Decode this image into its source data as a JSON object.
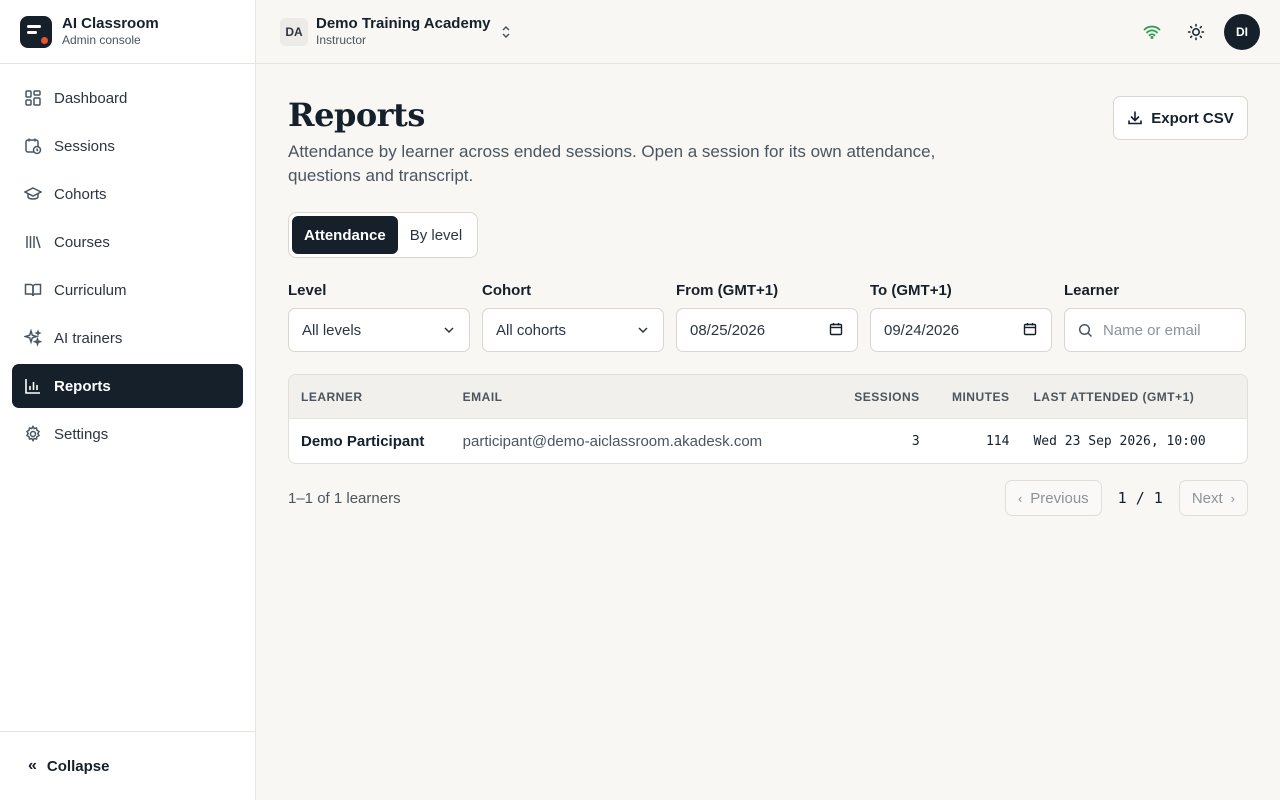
{
  "brand": {
    "title": "AI Classroom",
    "subtitle": "Admin console"
  },
  "org": {
    "badge": "DA",
    "name": "Demo Training Academy",
    "role": "Instructor"
  },
  "user": {
    "initials": "DI"
  },
  "sidebar": {
    "items": [
      {
        "label": "Dashboard",
        "icon": "dashboard-icon"
      },
      {
        "label": "Sessions",
        "icon": "sessions-icon"
      },
      {
        "label": "Cohorts",
        "icon": "cohorts-icon"
      },
      {
        "label": "Courses",
        "icon": "courses-icon"
      },
      {
        "label": "Curriculum",
        "icon": "curriculum-icon"
      },
      {
        "label": "AI trainers",
        "icon": "ai-trainers-icon"
      },
      {
        "label": "Reports",
        "icon": "reports-icon",
        "active": true
      },
      {
        "label": "Settings",
        "icon": "settings-icon"
      }
    ],
    "collapse_label": "Collapse"
  },
  "page": {
    "title": "Reports",
    "description": "Attendance by learner across ended sessions. Open a session for its own attendance, questions and transcript.",
    "export_label": "Export CSV"
  },
  "tabs": {
    "attendance": "Attendance",
    "by_level": "By level",
    "active": "attendance"
  },
  "filters": {
    "level": {
      "label": "Level",
      "value": "All levels"
    },
    "cohort": {
      "label": "Cohort",
      "value": "All cohorts"
    },
    "from": {
      "label": "From (GMT+1)",
      "value": "08/25/2026"
    },
    "to": {
      "label": "To (GMT+1)",
      "value": "09/24/2026"
    },
    "learner": {
      "label": "Learner",
      "placeholder": "Name or email"
    }
  },
  "table": {
    "headers": [
      "LEARNER",
      "EMAIL",
      "SESSIONS",
      "MINUTES",
      "LAST ATTENDED (GMT+1)"
    ],
    "rows": [
      {
        "learner": "Demo Participant",
        "email": "participant@demo-aiclassroom.akadesk.com",
        "sessions": "3",
        "minutes": "114",
        "last_attended": "Wed 23 Sep 2026, 10:00"
      }
    ]
  },
  "pagination": {
    "summary": "1–1 of 1 learners",
    "previous": "Previous",
    "next": "Next",
    "current": "1",
    "separator": "/",
    "total": "1"
  },
  "colors": {
    "accent": "#15202b",
    "brand_dot": "#e4572e",
    "online": "#2e9e4f",
    "background": "#f8f7f4"
  }
}
